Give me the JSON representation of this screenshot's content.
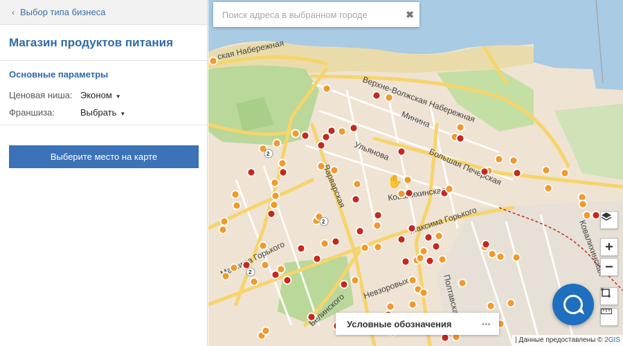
{
  "panel": {
    "back_label": "Выбор типа бизнеса",
    "title": "Магазин продуктов питания",
    "section_title": "Основные параметры",
    "params": [
      {
        "label": "Ценовая ниша:",
        "value": "Эконом"
      },
      {
        "label": "Франшиза:",
        "value": "Выбрать"
      }
    ],
    "cta_label": "Выберите место на карте"
  },
  "map": {
    "search_placeholder": "Поиск адреса в выбранном городе",
    "legend_label": "Условные обозначения",
    "legend_more": "···",
    "attribution_prefix": "| Данные предоставлены ©",
    "attribution_brand": "2GIS",
    "street_labels": [
      "Верхне-Волжская Набережная",
      "ская Набережная",
      "Минина",
      "Ульянова",
      "Большая Печерская",
      "Варварская",
      "Ковалихинская",
      "Максима Горького",
      "Полтавская",
      "Невзоровых",
      "Белинского",
      "Ковалихинская",
      "Максима Горького"
    ],
    "cluster_counts": [
      "2",
      "2",
      "2"
    ]
  },
  "colors": {
    "accent": "#3b72b8",
    "title_blue": "#2f6aa8",
    "water": "#a9cbe3",
    "park": "#b9d89a",
    "road": "#f6d46b",
    "marker_orange": "#f2992e",
    "marker_red": "#c8281c"
  },
  "icons": [
    "chevron-left-icon",
    "caret-down-icon",
    "close-icon",
    "layers-icon",
    "zoom-in-icon",
    "zoom-out-icon",
    "select-area-icon",
    "ruler-icon",
    "chat-icon",
    "hand-cursor-icon"
  ]
}
